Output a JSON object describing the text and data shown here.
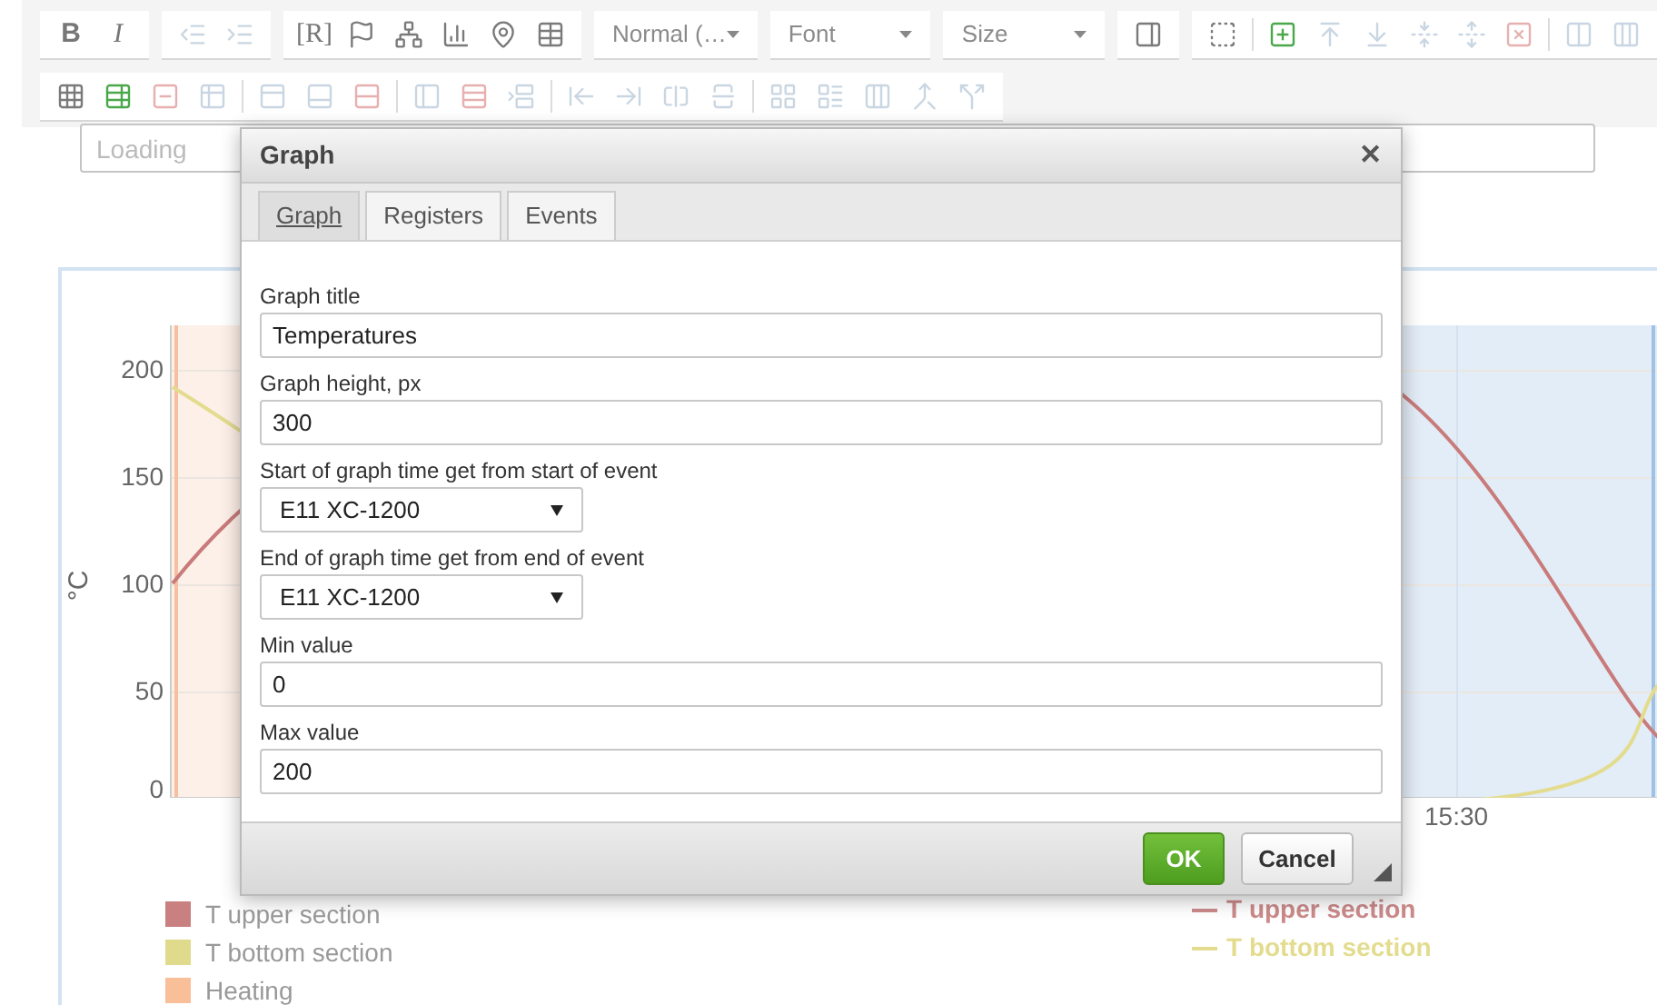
{
  "toolbar": {
    "rows": [
      {
        "groups": [
          {
            "kind": "buttons",
            "sections": [
              [
                {
                  "label": "B",
                  "disabled": false
                },
                {
                  "label": "I",
                  "disabled": false
                }
              ]
            ]
          },
          {
            "kind": "buttons",
            "sections": [
              [
                {
                  "disabled": true
                },
                {
                  "disabled": true
                }
              ]
            ]
          },
          {
            "kind": "buttons",
            "sections": [
              [
                {
                  "label": "[R]",
                  "disabled": false
                },
                {
                  "disabled": false
                },
                {
                  "disabled": false
                },
                {
                  "disabled": false
                },
                {
                  "disabled": false
                },
                {
                  "disabled": false
                }
              ]
            ]
          },
          {
            "kind": "combo",
            "value": "Normal (…"
          },
          {
            "kind": "combo",
            "value": "Font"
          },
          {
            "kind": "combo",
            "value": "Size"
          },
          {
            "kind": "buttons",
            "sections": [
              [
                {
                  "disabled": false
                }
              ]
            ]
          },
          {
            "kind": "buttons",
            "sections": [
              [
                {
                  "disabled": false
                }
              ],
              [
                {
                  "disabled": false
                },
                {
                  "disabled": true
                },
                {
                  "disabled": true
                },
                {
                  "disabled": true
                },
                {
                  "disabled": true
                },
                {
                  "disabled": true
                }
              ],
              [
                {
                  "disabled": true
                },
                {
                  "disabled": true
                }
              ]
            ]
          }
        ]
      },
      {
        "groups": [
          {
            "kind": "buttons",
            "sections": [
              [
                {
                  "disabled": false
                },
                {
                  "disabled": false
                },
                {
                  "disabled": true
                },
                {
                  "disabled": true
                }
              ],
              [
                {
                  "disabled": true
                },
                {
                  "disabled": true
                },
                {
                  "disabled": true
                }
              ],
              [
                {
                  "disabled": true
                },
                {
                  "disabled": true
                },
                {
                  "disabled": true
                }
              ],
              [
                {
                  "disabled": true
                },
                {
                  "disabled": true
                },
                {
                  "disabled": true
                },
                {
                  "disabled": true
                }
              ],
              [
                {
                  "disabled": true
                },
                {
                  "disabled": true
                },
                {
                  "disabled": true
                },
                {
                  "disabled": true
                },
                {
                  "disabled": true
                }
              ]
            ]
          }
        ]
      }
    ]
  },
  "loading_field": {
    "placeholder": "Loading"
  },
  "chart": {
    "y_label": "°C",
    "y_ticks": [
      "200",
      "150",
      "100",
      "50",
      "0"
    ],
    "x_ticks": [
      "15:30"
    ],
    "legend": [
      {
        "label": "T upper section",
        "color": "#c98080"
      },
      {
        "label": "T bottom section",
        "color": "#e0db8c"
      },
      {
        "label": "Heating",
        "color": "#f8bf98"
      }
    ],
    "line_legend": [
      {
        "label": "T upper section",
        "color": "#cc8a8a"
      },
      {
        "label": "T bottom section",
        "color": "#e3dc8f"
      }
    ]
  },
  "dialog": {
    "title": "Graph",
    "close": "✕",
    "tabs": [
      {
        "label": "Graph",
        "selected": true
      },
      {
        "label": "Registers",
        "selected": false
      },
      {
        "label": "Events",
        "selected": false
      }
    ],
    "fields": [
      {
        "kind": "text",
        "label": "Graph title",
        "value": "Temperatures"
      },
      {
        "kind": "text",
        "label": "Graph height, px",
        "value": "300"
      },
      {
        "kind": "select",
        "label": "Start of graph time get from start of event",
        "value": "E11 XC-1200"
      },
      {
        "kind": "select",
        "label": "End of graph time get from end of event",
        "value": "E11 XC-1200"
      },
      {
        "kind": "text",
        "label": "Min value",
        "value": "0"
      },
      {
        "kind": "text",
        "label": "Max value",
        "value": "200"
      }
    ],
    "buttons": [
      {
        "label": "OK",
        "kind": "primary"
      },
      {
        "label": "Cancel",
        "kind": "secondary"
      }
    ]
  }
}
